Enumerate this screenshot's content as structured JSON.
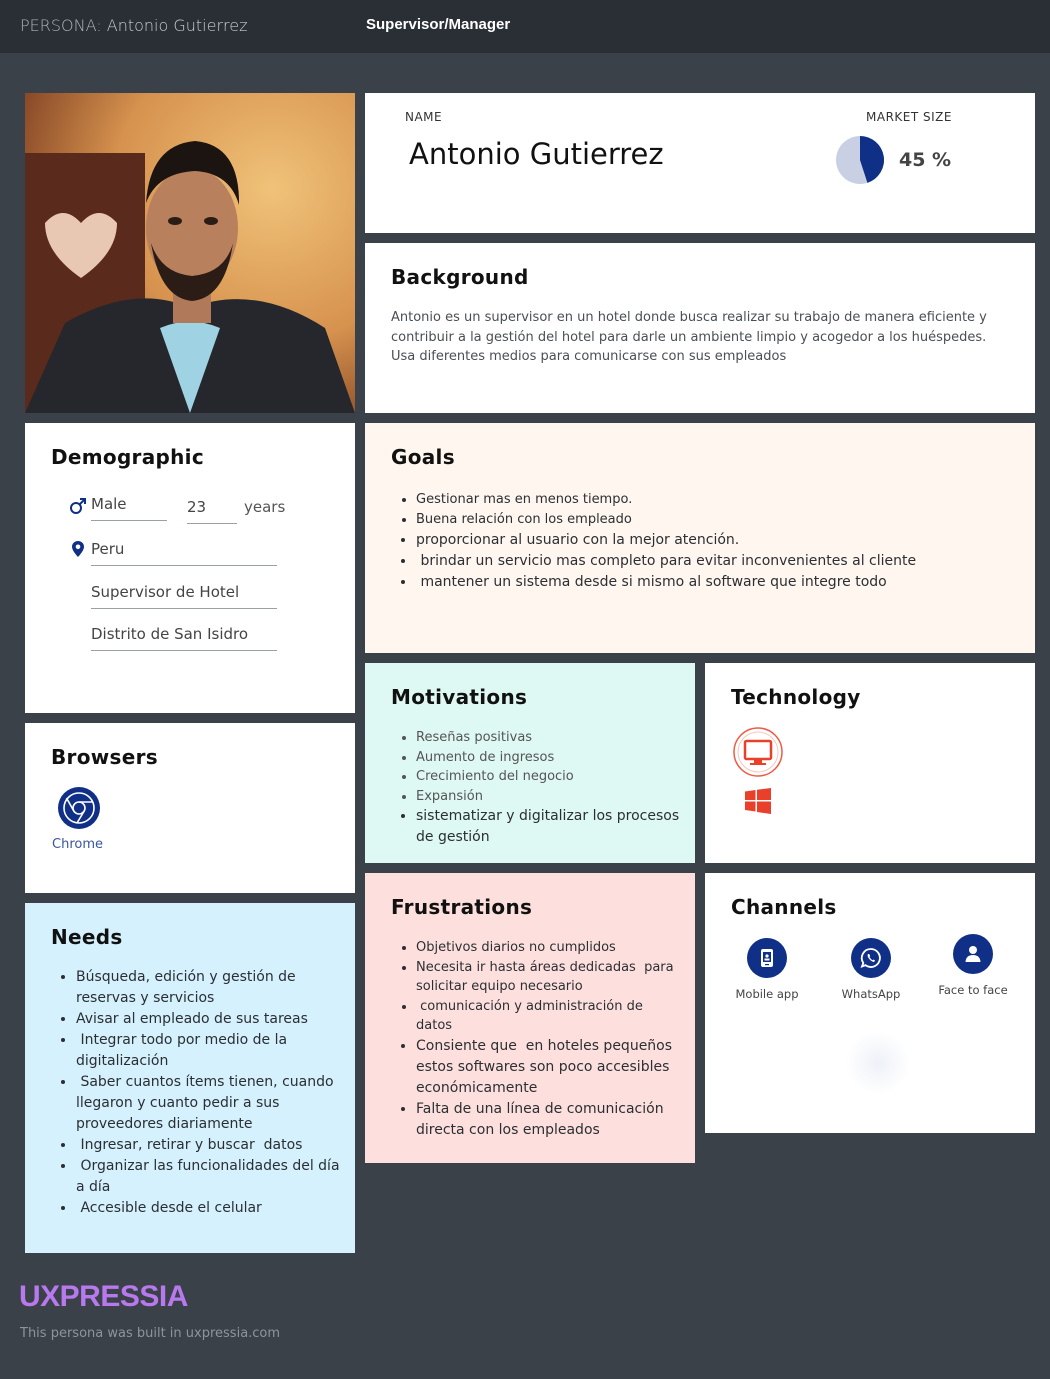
{
  "header": {
    "persona_prefix": "PERSONA:",
    "persona_name": "Antonio Gutierrez",
    "role": "Supervisor/Manager"
  },
  "name_card": {
    "name_label": "NAME",
    "name": "Antonio Gutierrez",
    "market_label": "MARKET SIZE",
    "market_value": "45 %",
    "market_fraction": 0.45
  },
  "background": {
    "title": "Background",
    "text": "Antonio es un supervisor en un hotel donde busca realizar su trabajo de manera eficiente y contribuir a la gestión del hotel para darle un ambiente limpio y acogedor a los huéspedes. Usa diferentes medios para comunicarse con sus empleados"
  },
  "demographic": {
    "title": "Demographic",
    "gender": "Male",
    "age": "23",
    "age_unit": "years",
    "location": "Peru",
    "occupation": "Supervisor de Hotel",
    "district": "Distrito de San Isidro"
  },
  "goals": {
    "title": "Goals",
    "items": [
      "Gestionar mas en menos tiempo.",
      "Buena relación con los empleado",
      "proporcionar al usuario con la mejor atención.",
      " brindar un servicio mas completo para evitar inconvenientes al cliente",
      " mantener un sistema desde si mismo al software que integre todo"
    ]
  },
  "motivations": {
    "title": "Motivations",
    "items": [
      "Reseñas positivas",
      "Aumento de ingresos",
      "Crecimiento del negocio",
      "Expansión",
      "sistematizar y digitalizar los procesos de gestión"
    ]
  },
  "technology": {
    "title": "Technology",
    "icons": [
      "desktop-icon",
      "windows-icon"
    ]
  },
  "browsers": {
    "title": "Browsers",
    "items": [
      {
        "name": "Chrome",
        "icon": "chrome-icon"
      }
    ]
  },
  "frustrations": {
    "title": "Frustrations",
    "items": [
      "Objetivos diarios no cumplidos",
      "Necesita ir hasta áreas dedicadas  para solicitar equipo necesario",
      " comunicación y administración de datos",
      "Consiente que  en hoteles pequeños estos softwares son poco accesibles económicamente",
      "Falta de una línea de comunicación directa con los empleados"
    ]
  },
  "channels": {
    "title": "Channels",
    "items": [
      {
        "label": "Mobile app",
        "icon": "mobile-app-icon"
      },
      {
        "label": "WhatsApp",
        "icon": "whatsapp-icon"
      },
      {
        "label": "Face to face",
        "icon": "person-icon"
      }
    ]
  },
  "needs": {
    "title": "Needs",
    "items": [
      "Búsqueda, edición y gestión de reservas y servicios",
      "Avisar al empleado de sus tareas",
      " Integrar todo por medio de la digitalización",
      " Saber cuantos ítems tienen, cuando llegaron y cuanto pedir a sus proveedores diariamente",
      " Ingresar, retirar y buscar  datos",
      " Organizar las funcionalidades del día a día",
      " Accesible desde el celular"
    ]
  },
  "footer": {
    "logo": "UXPRESSIA",
    "note": "This persona was built in uxpressia.com"
  },
  "colors": {
    "page": "#3b4149",
    "topbar": "#2a2f36",
    "goals_bg": "#fff6f0",
    "motivations_bg": "#def8f4",
    "frustrations_bg": "#fde0de",
    "needs_bg": "#d4f1fd",
    "accent": "#102f87",
    "logo": "#b879ee"
  }
}
